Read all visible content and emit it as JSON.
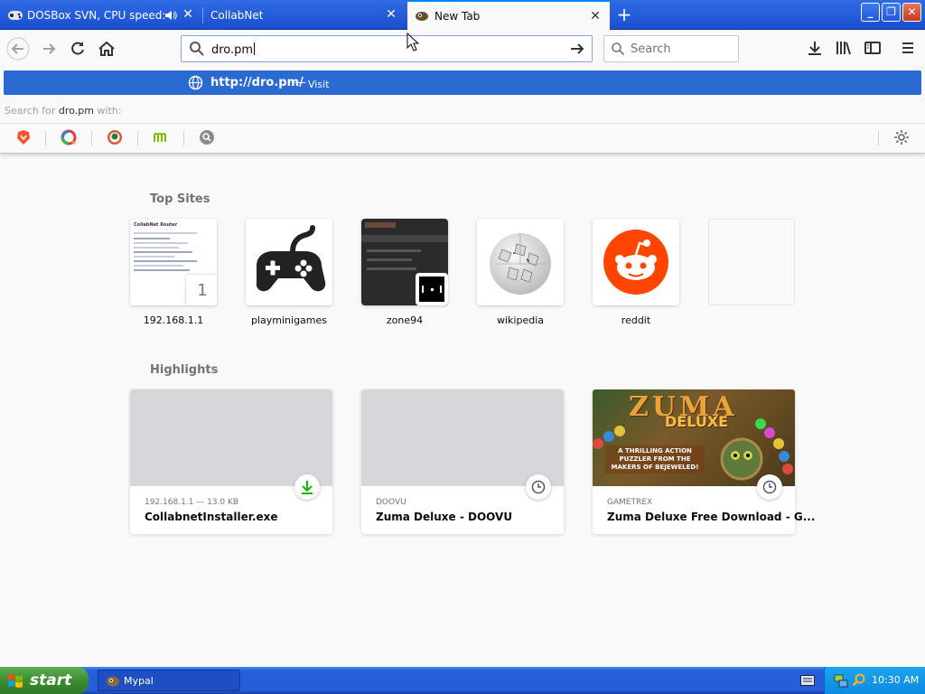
{
  "tabs": [
    {
      "title": "DOSBox SVN, CPU speed: max",
      "selected": false,
      "audio": true
    },
    {
      "title": "CollabNet",
      "selected": false
    },
    {
      "title": "New Tab",
      "selected": true
    }
  ],
  "urlbar": {
    "value": "dro.pm"
  },
  "searchbar": {
    "placeholder": "Search"
  },
  "popup": {
    "visit_url": "http://dro.pm/",
    "visit_dash": "—",
    "visit_action": "Visit",
    "search_prefix": "Search for",
    "search_term": "dro.pm",
    "search_suffix": "with:",
    "engines": [
      "brave-icon",
      "qwant-icon",
      "duckduckgo-icon",
      "mojeek-icon",
      "startpage-icon"
    ]
  },
  "top_sites": {
    "heading": "Top Sites",
    "items": [
      {
        "label": "192.168.1.1",
        "badge": "1",
        "thumb_title": "CollabNet Router"
      },
      {
        "label": "playminigames"
      },
      {
        "label": "zone94"
      },
      {
        "label": "wikipedia"
      },
      {
        "label": "reddit"
      },
      {
        "label": ""
      }
    ]
  },
  "highlights": {
    "heading": "Highlights",
    "items": [
      {
        "context": "192.168.1.1 — 13.0 KB",
        "title": "CollabnetInstaller.exe",
        "badge": "download-icon"
      },
      {
        "context": "DOOVU",
        "title": "Zuma Deluxe - DOOVU",
        "badge": "clock-icon"
      },
      {
        "context": "GAMETREX",
        "title": "Zuma Deluxe Free Download - G...",
        "badge": "clock-icon",
        "image_text": {
          "word1": "ZUMA",
          "word2": "DELUXE",
          "tagline": "A THRILLING ACTION PUZZLER FROM THE MAKERS OF BEJEWELED!"
        }
      }
    ]
  },
  "taskbar": {
    "start": "start",
    "task": "Mypal",
    "time": "10:30 AM"
  },
  "colors": {
    "accent": "#0a84ff",
    "visit_row": "#2a6ad1",
    "reddit": "#ff4500",
    "download": "#12bc00"
  }
}
